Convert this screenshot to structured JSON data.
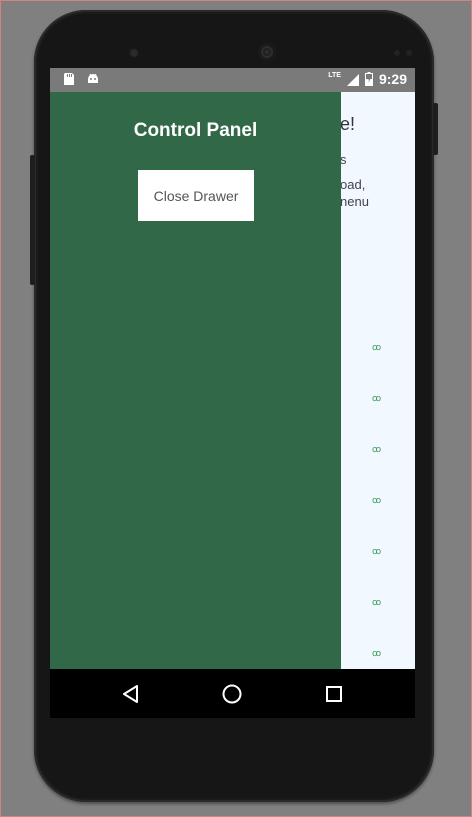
{
  "status_bar": {
    "time": "9:29",
    "network_label": "LTE",
    "left_icons": [
      "sd-card-icon",
      "android-debug-icon"
    ],
    "right_icons": [
      "signal-icon",
      "battery-charging-icon"
    ]
  },
  "background": {
    "title_fragment": "e!",
    "line1_fragment": "s",
    "line2_fragment": "oad,",
    "line3_fragment": "nenu",
    "glyph": "ꝏ",
    "glyph_color": "#3a9a5a",
    "background_color": "#f1f8ff"
  },
  "drawer": {
    "title": "Control Panel",
    "close_button_label": "Close Drawer",
    "background_color": "#316848"
  },
  "nav_bar": {
    "buttons": [
      "back-icon",
      "home-icon",
      "recents-icon"
    ]
  }
}
